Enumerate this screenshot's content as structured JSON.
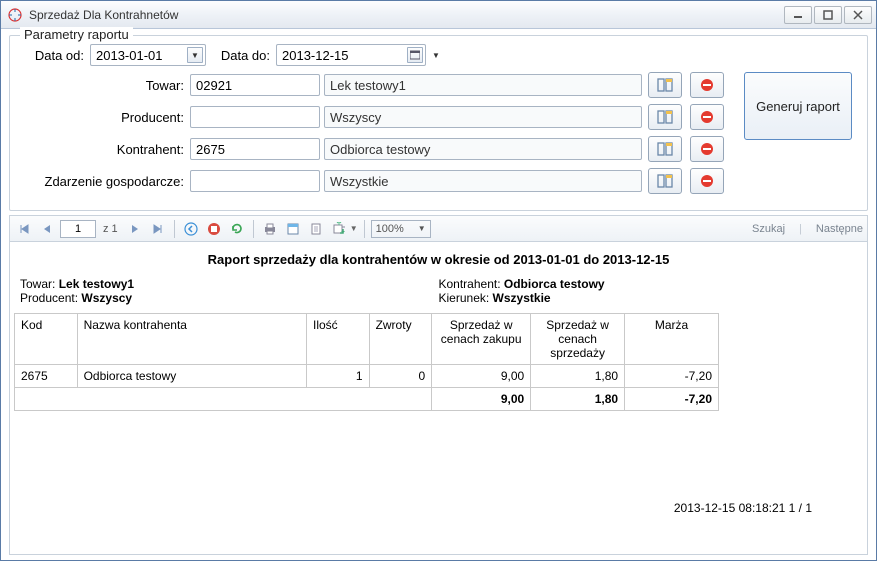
{
  "window": {
    "title": "Sprzedaż Dla Kontrahnetów"
  },
  "params": {
    "legend": "Parametry raportu",
    "date_from_label": "Data od:",
    "date_from_value": "2013-01-01",
    "date_to_label": "Data do:",
    "date_to_value": "2013-12-15",
    "towar_label": "Towar:",
    "towar_code": "02921",
    "towar_name": "Lek testowy1",
    "producent_label": "Producent:",
    "producent_code": "",
    "producent_name": "Wszyscy",
    "kontrahent_label": "Kontrahent:",
    "kontrahent_code": "2675",
    "kontrahent_name": "Odbiorca testowy",
    "zdarzenie_label": "Zdarzenie gospodarcze:",
    "zdarzenie_code": "",
    "zdarzenie_name": "Wszystkie",
    "generate_label": "Generuj raport"
  },
  "toolbar": {
    "page_current": "1",
    "page_of": "z 1",
    "zoom": "100%",
    "search": "Szukaj",
    "next": "Następne"
  },
  "report": {
    "title": "Raport sprzedaży dla kontrahentów w okresie od 2013-01-01 do 2013-12-15",
    "towar_label": "Towar:",
    "towar_value": "Lek testowy1",
    "producent_label": "Producent:",
    "producent_value": "Wszyscy",
    "kontrahent_label": "Kontrahent:",
    "kontrahent_value": "Odbiorca testowy",
    "kierunek_label": "Kierunek:",
    "kierunek_value": "Wszystkie",
    "headers": {
      "kod": "Kod",
      "nazwa": "Nazwa kontrahenta",
      "ilosc": "Ilość",
      "zwroty": "Zwroty",
      "sprzedaz_zakup": "Sprzedaż w cenach zakupu",
      "sprzedaz_sprzedaz": "Sprzedaż w cenach sprzedaży",
      "marza": "Marża"
    },
    "rows": [
      {
        "kod": "2675",
        "nazwa": "Odbiorca testowy",
        "ilosc": "1",
        "zwroty": "0",
        "sz": "9,00",
        "ss": "1,80",
        "marza": "-7,20"
      }
    ],
    "totals": {
      "sz": "9,00",
      "ss": "1,80",
      "marza": "-7,20"
    },
    "footer": "2013-12-15 08:18:21   1 / 1"
  }
}
